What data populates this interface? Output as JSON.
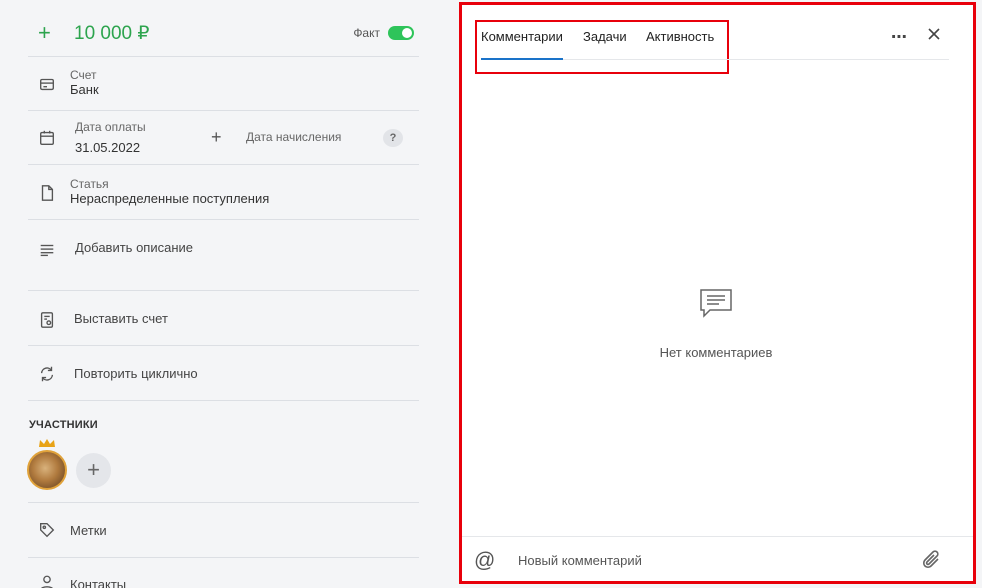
{
  "transaction": {
    "amount": "10 000 ₽",
    "fact_label": "Факт",
    "fact_enabled": true
  },
  "fields": {
    "account_label": "Счет",
    "account_value": "Банк",
    "payment_date_label": "Дата оплаты",
    "payment_date_value": "31.05.2022",
    "accrual_date_label": "Дата начисления",
    "help_mark": "?",
    "article_label": "Статья",
    "article_value": "Нераспределенные поступления",
    "add_description": "Добавить описание",
    "issue_invoice": "Выставить счет",
    "repeat_cyclic": "Повторить циклично",
    "participants_title": "УЧАСТНИКИ",
    "tags": "Метки",
    "contacts": "Контакты"
  },
  "panel": {
    "tabs": [
      {
        "label": "Комментарии",
        "active": true
      },
      {
        "label": "Задачи",
        "active": false
      },
      {
        "label": "Активность",
        "active": false
      }
    ],
    "more_icon": "⋯",
    "empty_text": "Нет комментариев",
    "comment_placeholder": "Новый комментарий",
    "at_symbol": "@"
  },
  "colors": {
    "accent_green": "#2da44e",
    "tab_active": "#1a73c9",
    "highlight_red": "#e8000b"
  }
}
